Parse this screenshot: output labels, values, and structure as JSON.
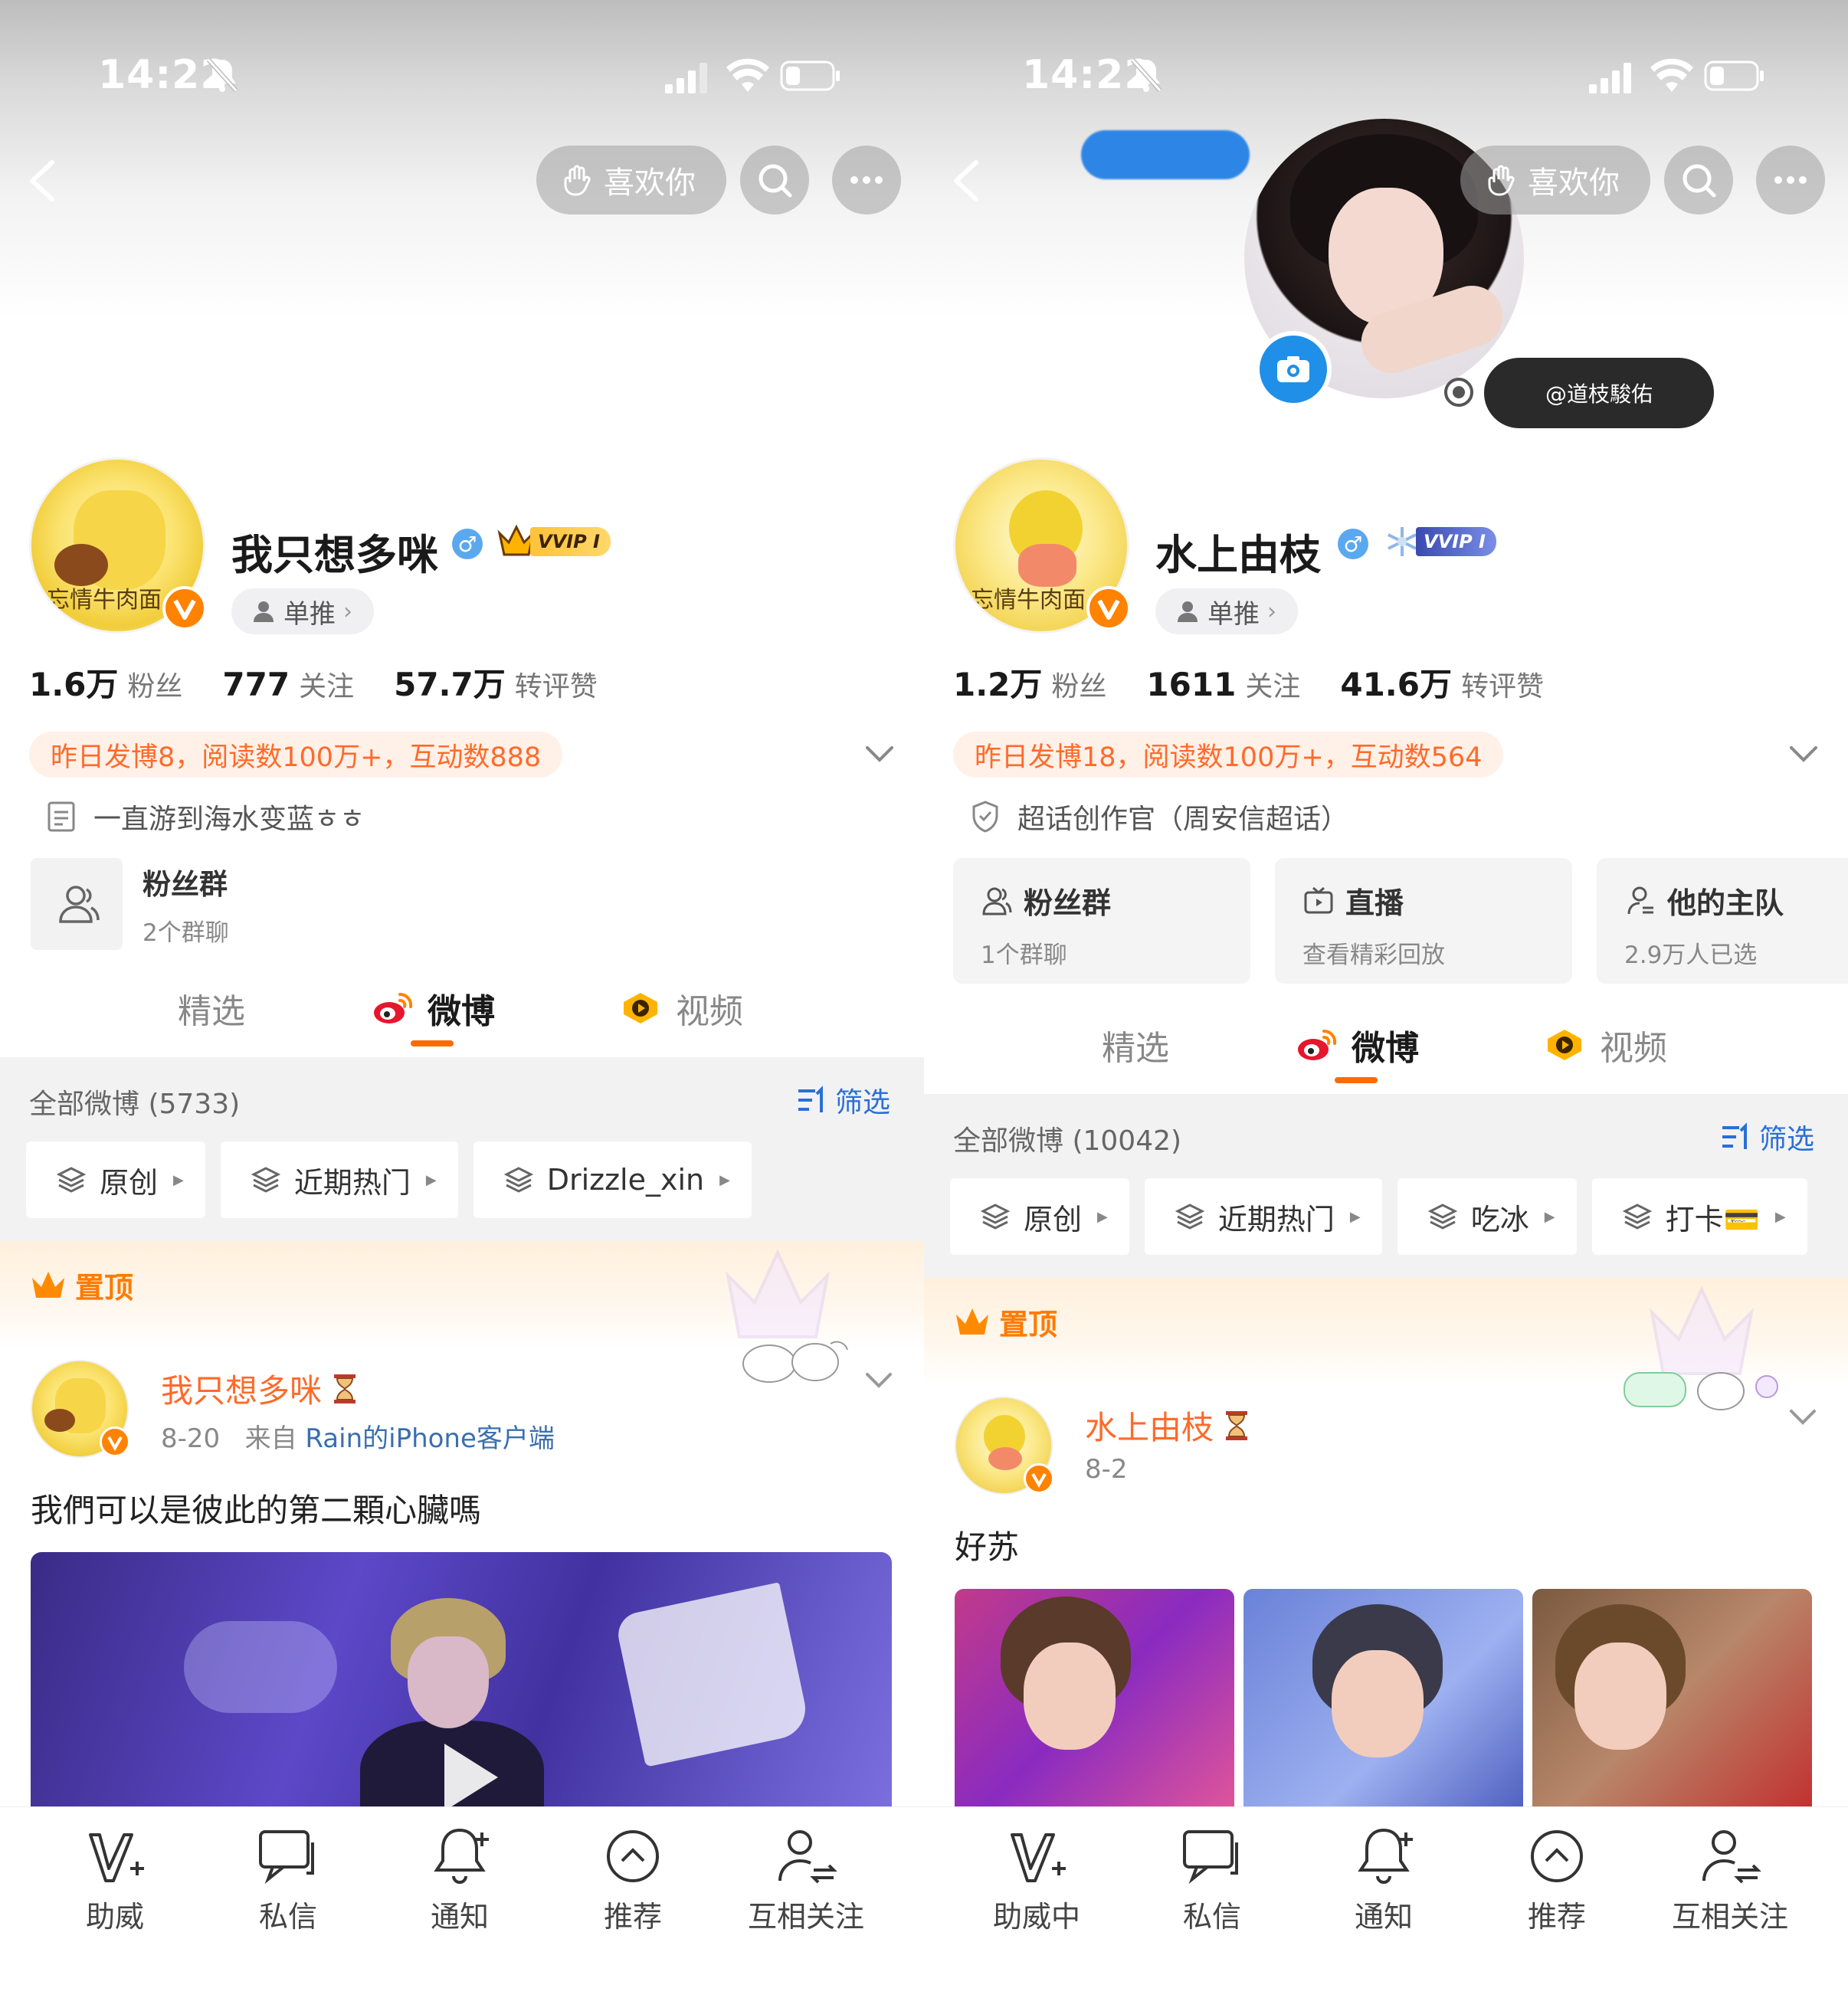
{
  "status_bar": {
    "time": "14:22"
  },
  "left": {
    "top_bar": {
      "like_label": "喜欢你"
    },
    "profile": {
      "name": "我只想多咪",
      "gender_symbol": "♂",
      "vip_label": "VVIP I",
      "avatar_text": "忘情牛肉面",
      "tag_label": "单推",
      "stats": [
        {
          "num": "1.6万",
          "label": "粉丝"
        },
        {
          "num": "777",
          "label": "关注"
        },
        {
          "num": "57.7万",
          "label": "转评赞"
        }
      ],
      "activity": "昨日发博8，阅读数100万+，互动数888",
      "bio": "一直游到海水变蓝ㅎㅎ"
    },
    "fan_group": {
      "title": "粉丝群",
      "sub": "2个群聊"
    },
    "tabs": [
      "精选",
      "微博",
      "视频"
    ],
    "filter": {
      "header": "全部微博 (5733)",
      "filter_label": "筛选",
      "chips": [
        "原创",
        "近期热门",
        "Drizzle_xin"
      ]
    },
    "pinned_label": "置顶",
    "post": {
      "author": "我只想多咪",
      "date": "8-20",
      "source_prefix": "来自",
      "source": "Rain的iPhone客户端",
      "text": "我們可以是彼此的第二顆心臟嗎"
    },
    "bottom_bar": [
      "助威",
      "私信",
      "通知",
      "推荐",
      "互相关注"
    ]
  },
  "right": {
    "top_bar": {
      "like_label": "喜欢你"
    },
    "photo_tag": "@道枝駿佑",
    "profile": {
      "name": "水上由枝",
      "gender_symbol": "♂",
      "vip_label": "VVIP I",
      "avatar_text": "忘情牛肉面",
      "tag_label": "单推",
      "stats": [
        {
          "num": "1.2万",
          "label": "粉丝"
        },
        {
          "num": "1611",
          "label": "关注"
        },
        {
          "num": "41.6万",
          "label": "转评赞"
        }
      ],
      "activity": "昨日发博18，阅读数100万+，互动数564",
      "bio": "超话创作官（周安信超话）"
    },
    "cards": [
      {
        "title": "粉丝群",
        "sub": "1个群聊",
        "icon": "users-icon"
      },
      {
        "title": "直播",
        "sub": "查看精彩回放",
        "icon": "tv-icon"
      },
      {
        "title": "他的主队",
        "sub": "2.9万人已选",
        "icon": "team-icon"
      }
    ],
    "tabs": [
      "精选",
      "微博",
      "视频"
    ],
    "filter": {
      "header": "全部微博 (10042)",
      "filter_label": "筛选",
      "chips": [
        "原创",
        "近期热门",
        "吃冰",
        "打卡💳"
      ]
    },
    "pinned_label": "置顶",
    "post": {
      "author": "水上由枝",
      "date": "8-2",
      "text": "好苏"
    },
    "bottom_bar": [
      "助威中",
      "私信",
      "通知",
      "推荐",
      "互相关注"
    ]
  },
  "colors": {
    "accent_orange": "#ff6a00",
    "link_blue": "#2a6fd6",
    "activity_text": "#ff6a2a",
    "activity_bg": "#fff1e8",
    "verified_orange": "#ff8200"
  }
}
